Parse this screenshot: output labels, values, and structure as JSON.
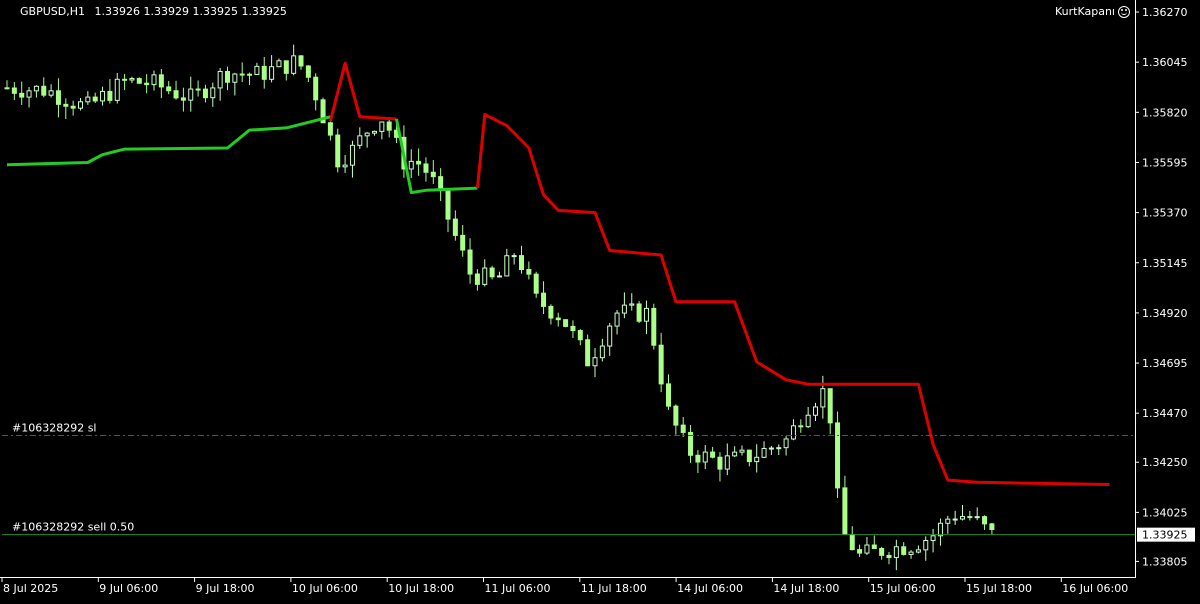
{
  "header": {
    "symbol": "GBPUSD,H1",
    "ohlc": "1.33926 1.33929 1.33925 1.33925",
    "brand": "KurtKapanı",
    "brand_icon": "smiley-icon"
  },
  "colors": {
    "background": "#000000",
    "bull_candle": "#c8ffc8",
    "bear_candle": "#aaff88",
    "trail_up": "#22cc22",
    "trail_down": "#dd0000",
    "sl_line": "#cc2222",
    "order_line": "#2a8a2a",
    "axis": "#ffffff"
  },
  "orders": [
    {
      "label": "#106328292 sl",
      "price": 1.3437,
      "style": "dash-dot"
    },
    {
      "label": "#106328292 sell 0.50",
      "price": 1.33925,
      "style": "solid"
    }
  ],
  "price_axis": {
    "ticks": [
      "1.36270",
      "1.36045",
      "1.35820",
      "1.35595",
      "1.35370",
      "1.35145",
      "1.34920",
      "1.34695",
      "1.34470",
      "1.34250",
      "1.34025",
      "1.33805"
    ],
    "current_price": "1.33925"
  },
  "time_axis": {
    "ticks": [
      "8 Jul 2025",
      "9 Jul 06:00",
      "9 Jul 18:00",
      "10 Jul 06:00",
      "10 Jul 18:00",
      "11 Jul 06:00",
      "11 Jul 18:00",
      "14 Jul 06:00",
      "14 Jul 18:00",
      "15 Jul 06:00",
      "15 Jul 18:00",
      "16 Jul 06:00"
    ]
  },
  "chart_data": {
    "type": "candlestick",
    "symbol": "GBPUSD",
    "timeframe": "H1",
    "ylim": [
      1.33735,
      1.36315
    ],
    "bar_count": 135,
    "trailing_stop_up": [
      [
        0,
        1.35585
      ],
      [
        11,
        1.35595
      ],
      [
        22,
        1.35605
      ],
      [
        27,
        1.35635
      ],
      [
        36,
        1.35655
      ],
      [
        48,
        1.35665
      ],
      [
        59,
        1.35665
      ],
      [
        63,
        1.3576
      ],
      [
        72,
        1.358
      ],
      [
        85,
        1.358
      ],
      [
        91,
        1.358
      ]
    ],
    "trailing_stop_down": [
      [
        91,
        1.35805
      ],
      [
        93,
        1.36045
      ],
      [
        96,
        1.35835
      ],
      [
        109,
        1.3581
      ]
    ],
    "trailing_stop_up_2": [
      [
        109,
        1.3581
      ],
      [
        112,
        1.35545
      ],
      [
        114,
        1.35535
      ],
      [
        116,
        1.35555
      ],
      [
        129,
        1.35555
      ],
      [
        130,
        1.35555
      ]
    ],
    "trailing_stop_down_2": [
      [
        130,
        1.35545
      ],
      [
        131,
        1.3583
      ],
      [
        134,
        1.3581
      ]
    ],
    "candles": [
      {
        "o": 1.3592,
        "h": 1.3607,
        "l": 1.3586,
        "c": 1.3595
      },
      {
        "o": 1.3595,
        "h": 1.3599,
        "l": 1.3587,
        "c": 1.3589
      },
      {
        "o": 1.3589,
        "h": 1.3596,
        "l": 1.3586,
        "c": 1.3593
      }
    ]
  }
}
